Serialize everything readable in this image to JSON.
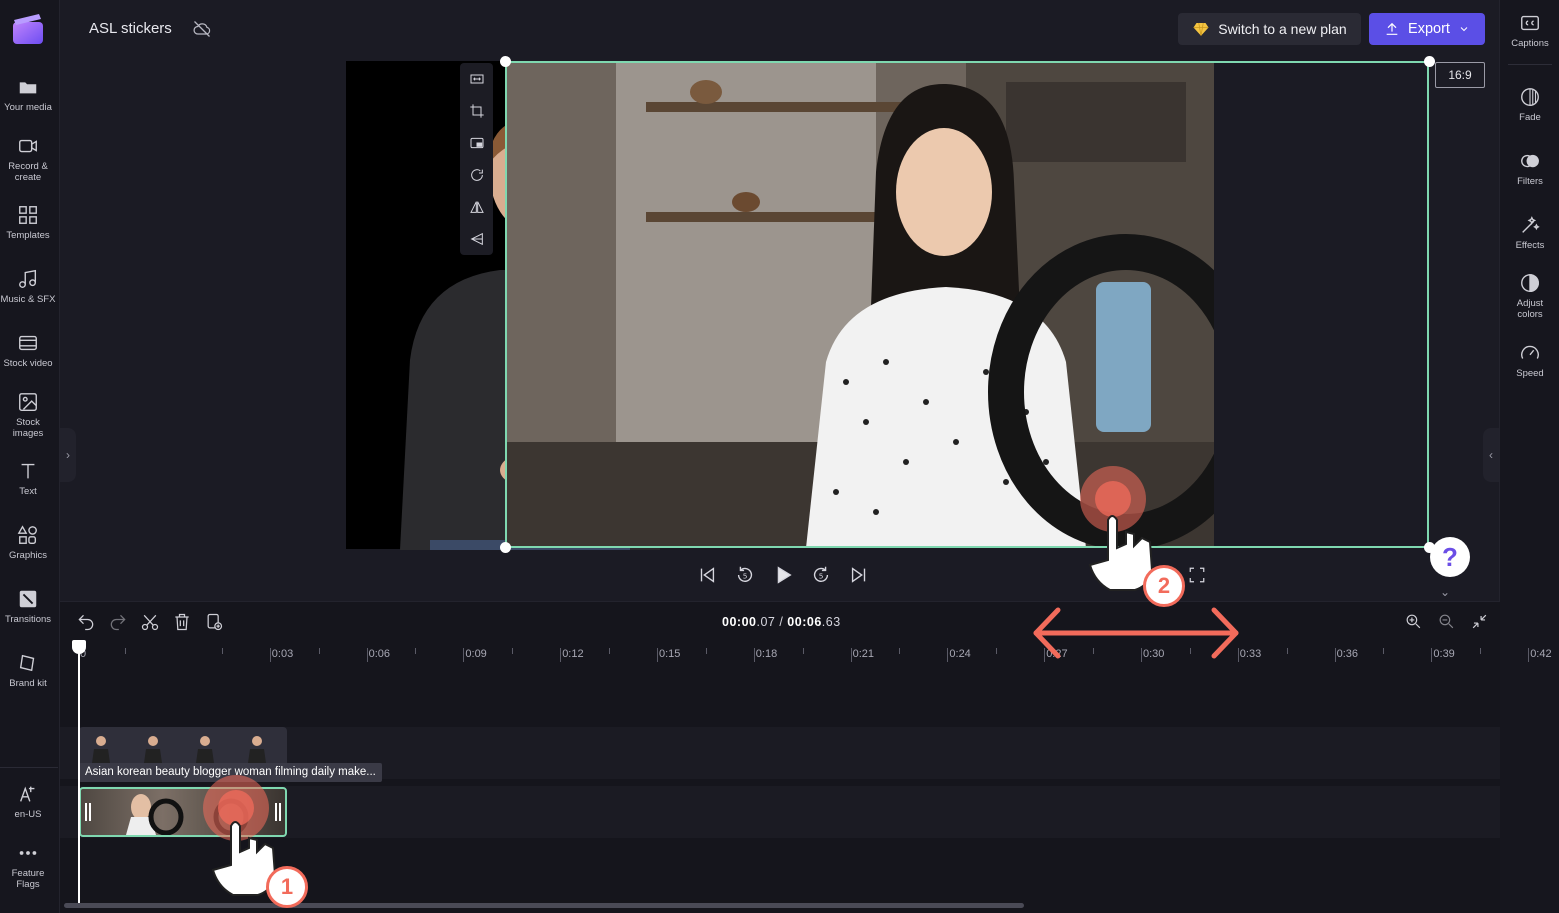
{
  "app": {
    "project_title": "ASL stickers",
    "accent_color": "#5b4fe6",
    "selection_color": "#7fd8b0",
    "annotation_color": "#f26b5b"
  },
  "left_rail": {
    "items": [
      {
        "label": "Your media",
        "icon": "folder-icon"
      },
      {
        "label": "Record & create",
        "icon": "camera-icon"
      },
      {
        "label": "Templates",
        "icon": "templates-icon"
      },
      {
        "label": "Music & SFX",
        "icon": "music-icon"
      },
      {
        "label": "Stock video",
        "icon": "film-icon"
      },
      {
        "label": "Stock images",
        "icon": "image-icon"
      },
      {
        "label": "Text",
        "icon": "text-icon"
      },
      {
        "label": "Graphics",
        "icon": "shapes-icon"
      },
      {
        "label": "Transitions",
        "icon": "transitions-icon"
      },
      {
        "label": "Brand kit",
        "icon": "brand-icon"
      }
    ],
    "bottom_items": [
      {
        "label": "en-US",
        "icon": "language-icon"
      },
      {
        "label": "Feature Flags",
        "icon": "more-icon"
      }
    ]
  },
  "right_rail": {
    "items": [
      {
        "label": "Captions",
        "icon": "captions-icon"
      },
      {
        "label": "Fade",
        "icon": "fade-icon"
      },
      {
        "label": "Filters",
        "icon": "filters-icon"
      },
      {
        "label": "Effects",
        "icon": "effects-icon"
      },
      {
        "label": "Adjust colors",
        "icon": "adjust-icon"
      },
      {
        "label": "Speed",
        "icon": "speed-icon"
      }
    ]
  },
  "header": {
    "plan_button": "Switch to a new plan",
    "export_button": "Export"
  },
  "preview": {
    "aspect_ratio": "16:9",
    "toolbar": [
      "fit-icon",
      "crop-icon",
      "pip-icon",
      "rotate-icon",
      "flip-icon",
      "perspective-icon"
    ]
  },
  "timeline": {
    "current_time_prefix": "00:00",
    "current_time_suffix": ".07",
    "separator": " / ",
    "total_time_prefix": "00:06",
    "total_time_suffix": ".63",
    "ticks": [
      "0",
      "0:03",
      "0:06",
      "0:09",
      "0:12",
      "0:15",
      "0:18",
      "0:21",
      "0:24",
      "0:27",
      "0:30",
      "0:33",
      "0:36",
      "0:39",
      "0:42"
    ],
    "clip_title": "Asian korean beauty blogger woman filming daily make..."
  },
  "annotations": {
    "step1": "1",
    "step2": "2"
  }
}
